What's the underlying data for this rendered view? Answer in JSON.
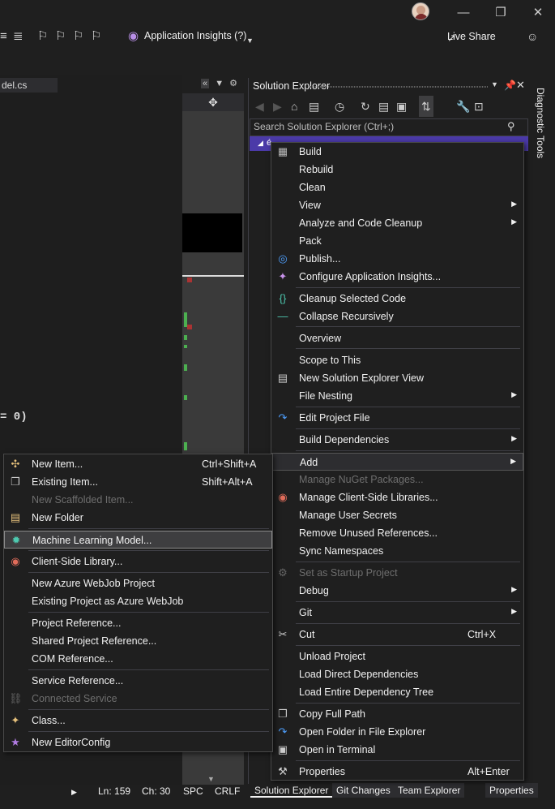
{
  "toolbar": {
    "app_insights_label": "Application Insights (?)",
    "live_share_label": "Live Share"
  },
  "editor": {
    "doc_tab_label": "del.cs",
    "code_fragment": "= 0)"
  },
  "solution_explorer": {
    "title": "Solution Explorer",
    "search_placeholder": "Search Solution Explorer (Ctrl+;)",
    "selected_prefix": "é"
  },
  "diagnostic_tools": {
    "label": "Diagnostic Tools"
  },
  "status": {
    "line": "Ln: 159",
    "col": "Ch: 30",
    "spc": "SPC",
    "eol": "CRLF"
  },
  "bottom_tabs": [
    "Solution Explorer",
    "Git Changes",
    "Team Explorer",
    "Properties"
  ],
  "project_menu": [
    {
      "label": "Build",
      "icon": "build-icon"
    },
    {
      "label": "Rebuild"
    },
    {
      "label": "Clean"
    },
    {
      "label": "View",
      "submenu": true
    },
    {
      "label": "Analyze and Code Cleanup",
      "submenu": true
    },
    {
      "label": "Pack"
    },
    {
      "label": "Publish...",
      "icon": "globe-icon"
    },
    {
      "label": "Configure Application Insights...",
      "icon": "lightbulb-icon"
    },
    {
      "label": "Cleanup Selected Code",
      "icon": "braces-icon"
    },
    {
      "label": "Collapse Recursively",
      "icon": "collapse-icon"
    },
    {
      "label": "Overview"
    },
    {
      "label": "Scope to This"
    },
    {
      "label": "New Solution Explorer View",
      "icon": "window-icon"
    },
    {
      "label": "File Nesting",
      "submenu": true
    },
    {
      "label": "Edit Project File",
      "icon": "redo-icon"
    },
    {
      "label": "Build Dependencies",
      "submenu": true
    },
    {
      "label": "Add",
      "submenu": true
    },
    {
      "label": "Manage NuGet Packages...",
      "disabled": true
    },
    {
      "label": "Manage Client-Side Libraries...",
      "icon": "library-icon"
    },
    {
      "label": "Manage User Secrets"
    },
    {
      "label": "Remove Unused References..."
    },
    {
      "label": "Sync Namespaces"
    },
    {
      "label": "Set as Startup Project",
      "disabled": true,
      "icon": "gear-icon"
    },
    {
      "label": "Debug",
      "submenu": true
    },
    {
      "label": "Git",
      "submenu": true
    },
    {
      "label": "Cut",
      "shortcut": "Ctrl+X",
      "icon": "scissors-icon"
    },
    {
      "label": "Unload Project"
    },
    {
      "label": "Load Direct Dependencies"
    },
    {
      "label": "Load Entire Dependency Tree"
    },
    {
      "label": "Copy Full Path",
      "icon": "copy-icon"
    },
    {
      "label": "Open Folder in File Explorer",
      "icon": "redo-icon"
    },
    {
      "label": "Open in Terminal",
      "icon": "terminal-icon"
    },
    {
      "label": "Properties",
      "shortcut": "Alt+Enter",
      "icon": "wrench-icon"
    }
  ],
  "add_menu": [
    {
      "label": "New Item...",
      "shortcut": "Ctrl+Shift+A",
      "icon": "new-item-icon"
    },
    {
      "label": "Existing Item...",
      "shortcut": "Shift+Alt+A",
      "icon": "existing-item-icon"
    },
    {
      "label": "New Scaffolded Item...",
      "disabled": true
    },
    {
      "label": "New Folder",
      "icon": "folder-icon"
    },
    {
      "label": "Machine Learning Model...",
      "icon": "ml-model-icon",
      "highlighted": true
    },
    {
      "label": "Client-Side Library...",
      "icon": "library-icon"
    },
    {
      "label": "New Azure WebJob Project"
    },
    {
      "label": "Existing Project as Azure WebJob"
    },
    {
      "label": "Project Reference..."
    },
    {
      "label": "Shared Project Reference..."
    },
    {
      "label": "COM Reference..."
    },
    {
      "label": "Service Reference..."
    },
    {
      "label": "Connected Service",
      "disabled": true,
      "icon": "connected-service-icon"
    },
    {
      "label": "Class...",
      "icon": "class-icon"
    },
    {
      "label": "New EditorConfig",
      "icon": "editorconfig-icon"
    }
  ],
  "colors": {
    "accent": "#4b3aa8",
    "menu_bg": "#1f1f1f",
    "highlight_border": "#8a8a8a"
  }
}
